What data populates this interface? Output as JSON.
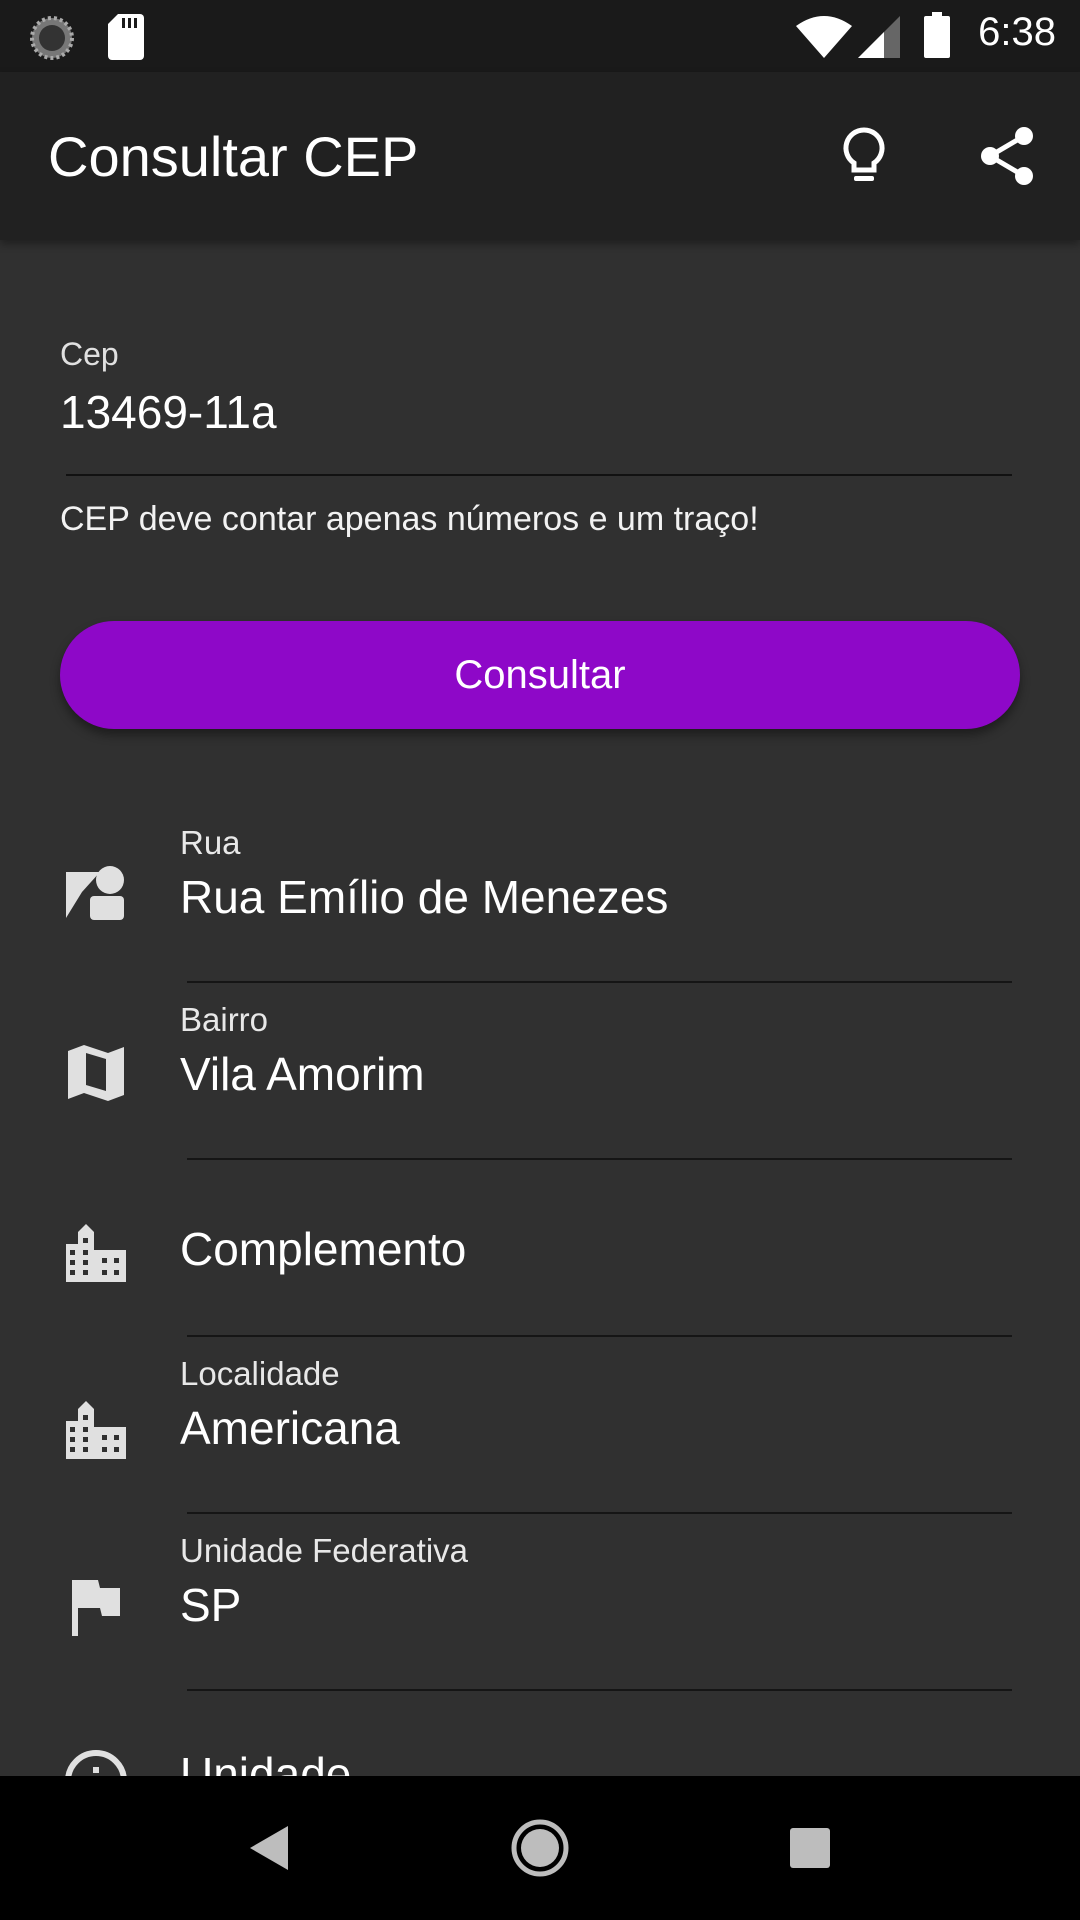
{
  "status_bar": {
    "time": "6:38",
    "icons": [
      "sync-icon",
      "sd-card-icon",
      "wifi-icon",
      "signal-icon",
      "battery-icon"
    ]
  },
  "app_bar": {
    "title": "Consultar CEP",
    "actions": [
      "lightbulb-icon",
      "share-icon"
    ]
  },
  "form": {
    "cep_label": "Cep",
    "cep_value": "13469-11a",
    "cep_error": "CEP deve contar apenas números e um traço!",
    "submit_label": "Consultar",
    "accent_color": "#8e08c8"
  },
  "fields": [
    {
      "icon": "street-person-icon",
      "label": "Rua",
      "value": "Rua Emílio de Menezes"
    },
    {
      "icon": "map-icon",
      "label": "Bairro",
      "value": "Vila Amorim"
    },
    {
      "icon": "city-icon",
      "label": "",
      "value": "Complemento"
    },
    {
      "icon": "city-icon",
      "label": "Localidade",
      "value": "Americana"
    },
    {
      "icon": "flag-icon",
      "label": "Unidade Federativa",
      "value": "SP"
    },
    {
      "icon": "info-icon",
      "label": "",
      "value": "Unidade"
    }
  ],
  "nav_bar": {
    "icons": [
      "back-icon",
      "home-icon",
      "recents-icon"
    ]
  }
}
